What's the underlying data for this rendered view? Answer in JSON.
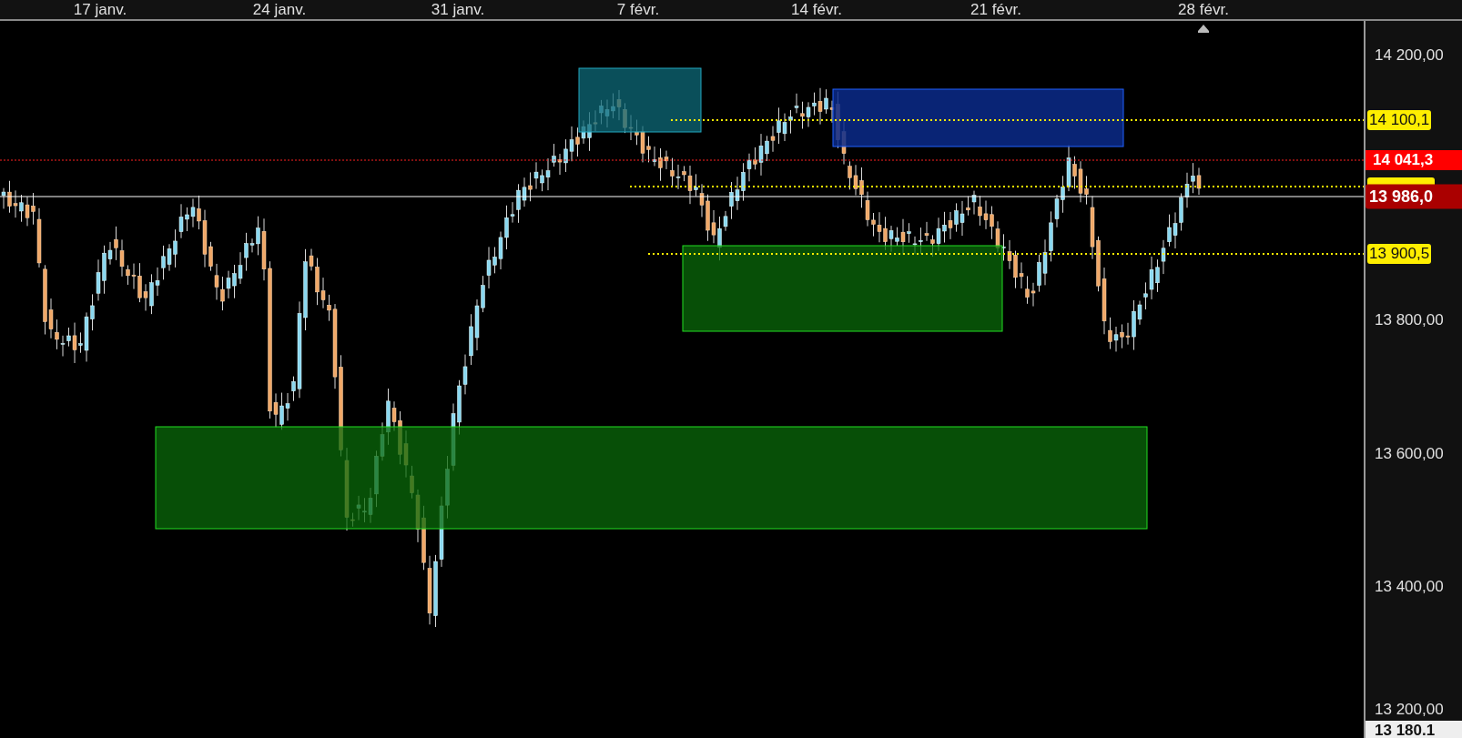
{
  "time_axis": {
    "labels": [
      "17 janv.",
      "24 janv.",
      "31 janv.",
      "7 févr.",
      "14 févr.",
      "21 févr.",
      "28 févr."
    ]
  },
  "price_axis": {
    "labels": [
      "14 200,00",
      "13 800,00",
      "13 600,00",
      "13 400,00",
      "13 200,00"
    ]
  },
  "price_tags": [
    {
      "text": "14 100,1",
      "kind": "level"
    },
    {
      "text": "14 041,3",
      "kind": "alert"
    },
    {
      "text": "13 986,0",
      "kind": "last"
    },
    {
      "text": "13 900,5",
      "kind": "level"
    },
    {
      "text": "13 180.1",
      "kind": "cursor"
    }
  ]
}
